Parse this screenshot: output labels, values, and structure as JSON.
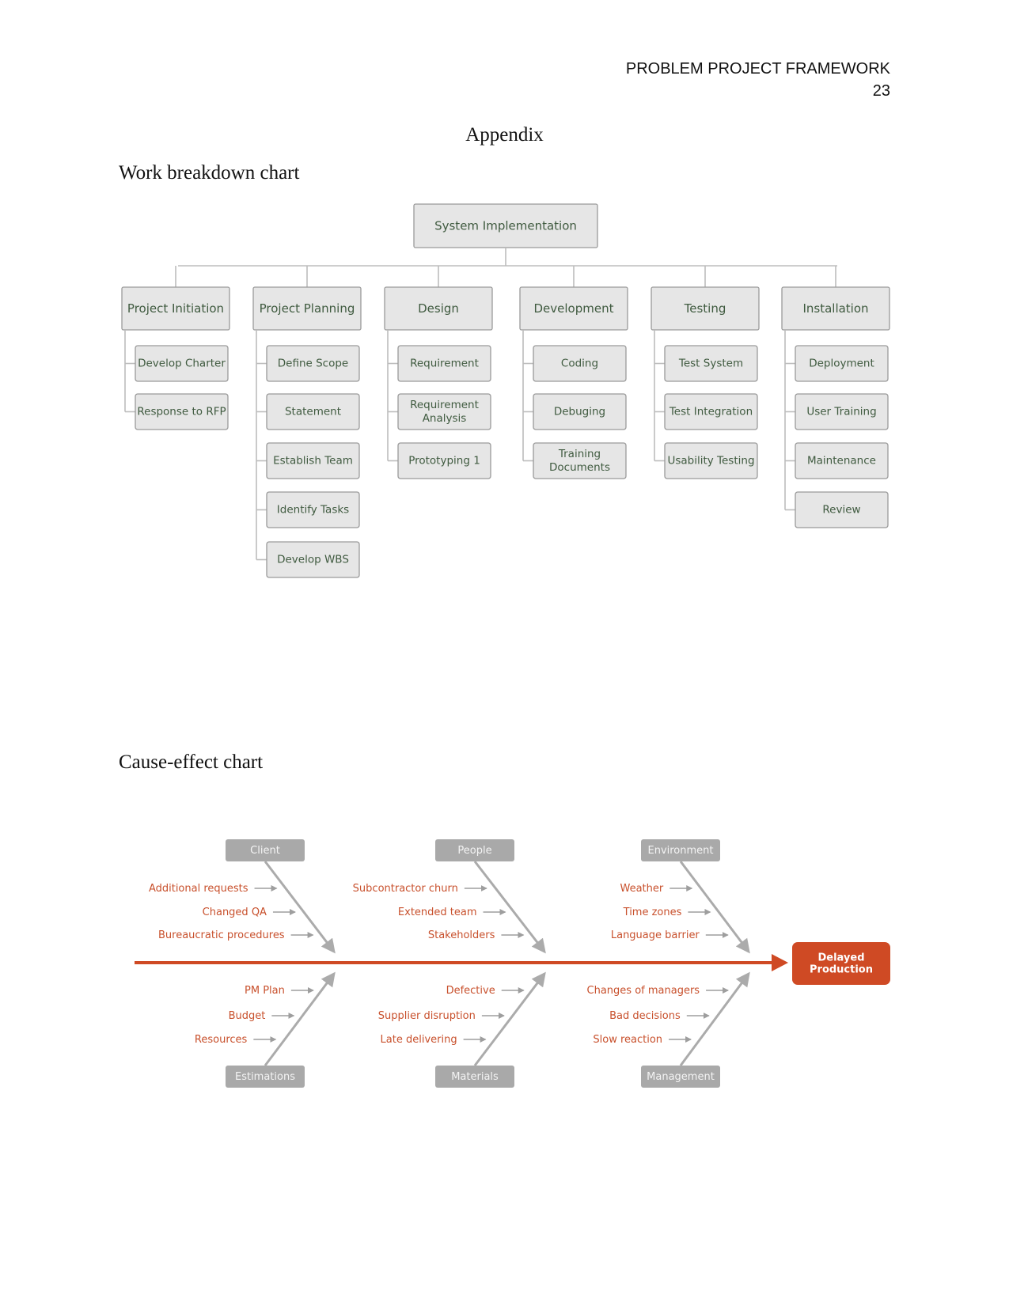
{
  "header": {
    "running_head": "PROBLEM PROJECT FRAMEWORK",
    "page_number": "23"
  },
  "titles": {
    "appendix": "Appendix",
    "wbs_heading": "Work breakdown chart",
    "cause_effect_heading": "Cause-effect chart"
  },
  "wbs": {
    "root": "System Implementation",
    "phases": [
      {
        "label": "Project Initiation",
        "tasks": [
          "Develop Charter",
          "Response to RFP"
        ]
      },
      {
        "label": "Project Planning",
        "tasks": [
          "Define Scope",
          "Statement",
          "Establish Team",
          "Identify Tasks",
          "Develop WBS"
        ]
      },
      {
        "label": "Design",
        "tasks": [
          "Requirement",
          "Requirement\nAnalysis",
          "Prototyping 1"
        ]
      },
      {
        "label": "Development",
        "tasks": [
          "Coding",
          "Debuging",
          "Training\nDocuments"
        ]
      },
      {
        "label": "Testing",
        "tasks": [
          "Test System",
          "Test Integration",
          "Usability Testing"
        ]
      },
      {
        "label": "Installation",
        "tasks": [
          "Deployment",
          "User Training",
          "Maintenance",
          "Review"
        ]
      }
    ]
  },
  "fishbone": {
    "effect": "Delayed\nProduction",
    "colors": {
      "accent": "#cf4a24",
      "category": "#a9a9a9",
      "bone": "#ababab",
      "cause_text": "#c8502c"
    },
    "top_categories": [
      {
        "label": "Client",
        "causes": [
          "Additional requests",
          "Changed QA",
          "Bureaucratic procedures"
        ]
      },
      {
        "label": "People",
        "causes": [
          "Subcontractor churn",
          "Extended team",
          "Stakeholders"
        ]
      },
      {
        "label": "Environment",
        "causes": [
          "Weather",
          "Time zones",
          "Language barrier"
        ]
      }
    ],
    "bottom_categories": [
      {
        "label": "Estimations",
        "causes": [
          "PM Plan",
          "Budget",
          "Resources"
        ]
      },
      {
        "label": "Materials",
        "causes": [
          "Defective",
          "Supplier disruption",
          "Late delivering"
        ]
      },
      {
        "label": "Management",
        "causes": [
          "Changes of managers",
          "Bad decisions",
          "Slow reaction"
        ]
      }
    ]
  }
}
